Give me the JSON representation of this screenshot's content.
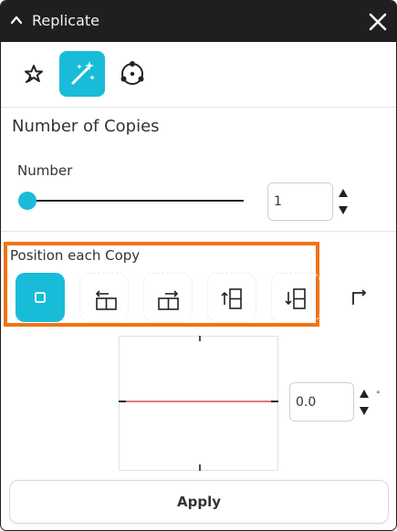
{
  "window": {
    "title": "Replicate"
  },
  "modes": [
    {
      "icon": "pin-star-icon",
      "active": false
    },
    {
      "icon": "magic-wand-icon",
      "active": true
    },
    {
      "icon": "orbit-icon",
      "active": false
    }
  ],
  "copies": {
    "section_title": "Number of Copies",
    "number_label": "Number",
    "number_value": "1",
    "slider_fraction": 0
  },
  "position": {
    "label": "Position each Copy",
    "options": [
      {
        "icon": "square-icon",
        "active": true
      },
      {
        "icon": "arrow-left-box-icon",
        "active": false
      },
      {
        "icon": "arrow-right-box-icon",
        "active": false
      },
      {
        "icon": "arrow-up-box-icon",
        "active": false
      },
      {
        "icon": "arrow-down-box-icon",
        "active": false
      },
      {
        "icon": "corner-arrow-icon",
        "active": false
      }
    ]
  },
  "angle": {
    "value": "0.0",
    "unit": "°"
  },
  "apply_label": "Apply",
  "colors": {
    "accent": "#19bcd8",
    "highlight": "#f07316",
    "preview_line": "#e07a7a",
    "titlebar": "#1f1f1f"
  }
}
